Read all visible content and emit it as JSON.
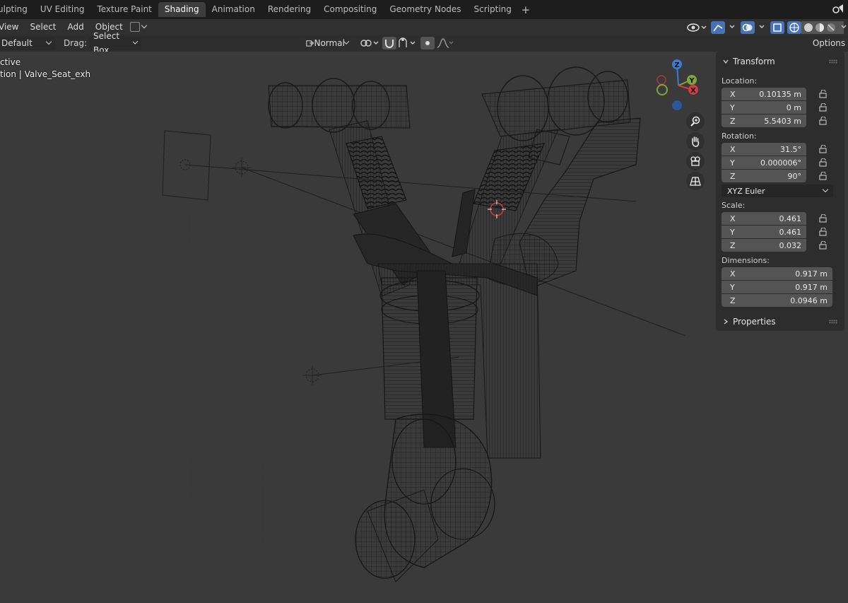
{
  "workspace_tabs": [
    "ulpting",
    "UV Editing",
    "Texture Paint",
    "Shading",
    "Animation",
    "Rendering",
    "Compositing",
    "Geometry Nodes",
    "Scripting"
  ],
  "active_tab": "Shading",
  "add_tab_label": "+",
  "header_menu": [
    "View",
    "Select",
    "Add",
    "Object"
  ],
  "toolbar": {
    "orientation_value": "Default",
    "drag_label": "Drag:",
    "drag_value": "Select Box",
    "transform_orientation_value": "Normal",
    "options_label": "Options"
  },
  "viewport": {
    "overlay_line1": "ctive",
    "overlay_line2": "tion | Valve_Seat_exh"
  },
  "gizmo": {
    "z_label": "Z",
    "y_label": "Y",
    "x_label": "X",
    "z_color": "#3a7bd5",
    "y_color": "#7ea63b",
    "x_color": "#d23b47"
  },
  "nav_icons": [
    "zoom-icon",
    "hand-pan-icon",
    "camera-view-icon",
    "grid-perspective-icon"
  ],
  "sidebar": {
    "transform_title": "Transform",
    "location_label": "Location:",
    "location": [
      {
        "axis": "X",
        "value": "0.10135 m"
      },
      {
        "axis": "Y",
        "value": "0 m"
      },
      {
        "axis": "Z",
        "value": "5.5403 m"
      }
    ],
    "rotation_label": "Rotation:",
    "rotation": [
      {
        "axis": "X",
        "value": "31.5°"
      },
      {
        "axis": "Y",
        "value": "0.000006°"
      },
      {
        "axis": "Z",
        "value": "90°"
      }
    ],
    "rotation_mode": "XYZ Euler",
    "scale_label": "Scale:",
    "scale": [
      {
        "axis": "X",
        "value": "0.461"
      },
      {
        "axis": "Y",
        "value": "0.461"
      },
      {
        "axis": "Z",
        "value": "0.032"
      }
    ],
    "dimensions_label": "Dimensions:",
    "dimensions": [
      {
        "axis": "X",
        "value": "0.917 m"
      },
      {
        "axis": "Y",
        "value": "0.917 m"
      },
      {
        "axis": "Z",
        "value": "0.0946 m"
      }
    ],
    "properties_title": "Properties"
  }
}
